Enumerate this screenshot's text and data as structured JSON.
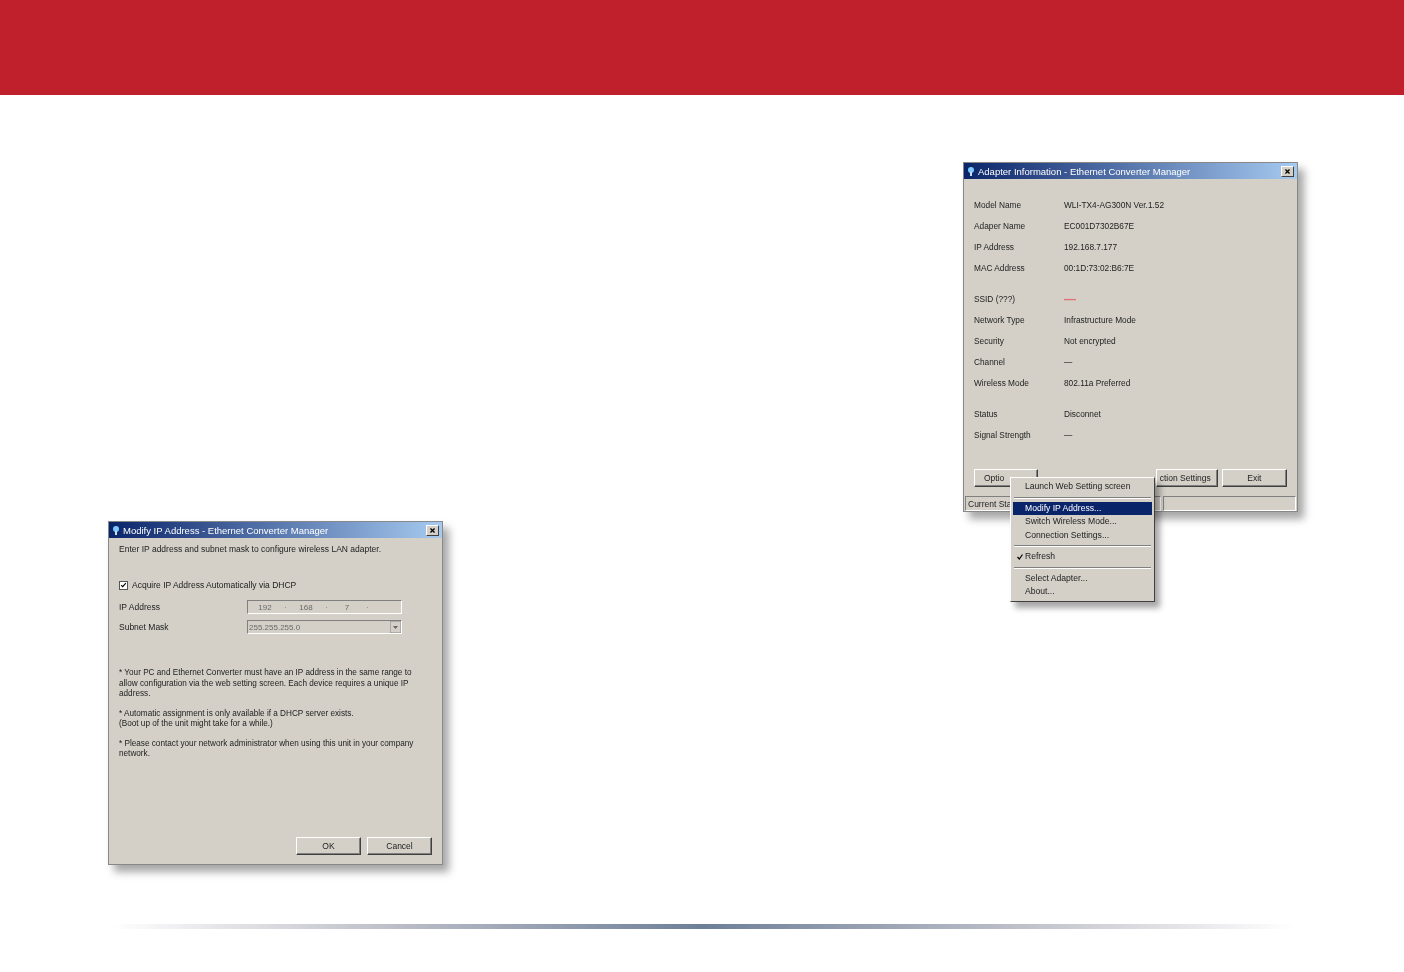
{
  "modify_dialog": {
    "title": "Modify IP Address - Ethernet Converter Manager",
    "instruction": "Enter IP address and subnet mask to configure wireless LAN adapter.",
    "dhcp_checkbox": {
      "label": "Acquire IP Address Automatically via DHCP",
      "checked": true
    },
    "ip_address": {
      "label": "IP Address",
      "octets": [
        "192",
        "168",
        "7"
      ],
      "disabled": true
    },
    "subnet_mask": {
      "label": "Subnet Mask",
      "value": "255.255.255.0",
      "disabled": true
    },
    "notes": [
      "* Your PC and Ethernet Converter must have an IP address in the same range to allow configuration via the web setting screen. Each device requires a unique IP address.",
      "* Automatic assignment is only available if a DHCP server exists.\n (Boot up of the unit might take for a while.)",
      "* Please contact your network administrator when using this unit in your company network."
    ],
    "buttons": [
      "OK",
      "Cancel"
    ]
  },
  "adapter_dialog": {
    "title": "Adapter Information - Ethernet Converter Manager",
    "groups": [
      [
        {
          "label": "Model Name",
          "value": "WLI-TX4-AG300N Ver.1.52"
        },
        {
          "label": "Adaper Name",
          "value": "EC001D7302B67E"
        },
        {
          "label": "IP Address",
          "value": "192.168.7.177"
        },
        {
          "label": "MAC Address",
          "value": "00:1D:73:02:B6:7E"
        }
      ],
      [
        {
          "label": "SSID  (???)",
          "value": "—",
          "color": "#e07070"
        },
        {
          "label": "Network Type",
          "value": "Infrastructure Mode"
        },
        {
          "label": "Security",
          "value": "Not encrypted"
        },
        {
          "label": "Channel",
          "value": "—"
        },
        {
          "label": "Wireless Mode",
          "value": "802.11a Preferred"
        }
      ],
      [
        {
          "label": "Status",
          "value": "Disconnet"
        },
        {
          "label": "Signal Strength",
          "value": "—"
        }
      ]
    ],
    "buttons": [
      "Optio",
      "ction Settings",
      "Exit"
    ],
    "status_bar": [
      "Current Sta"
    ]
  },
  "context_menu": {
    "items": [
      {
        "kind": "item",
        "label": "Launch Web Setting screen",
        "selected": false,
        "checked": false
      },
      {
        "kind": "separator"
      },
      {
        "kind": "item",
        "label": "Modify IP Address...",
        "selected": true,
        "checked": false
      },
      {
        "kind": "item",
        "label": "Switch Wireless Mode...",
        "selected": false,
        "checked": false
      },
      {
        "kind": "item",
        "label": "Connection Settings...",
        "selected": false,
        "checked": false
      },
      {
        "kind": "separator"
      },
      {
        "kind": "item",
        "label": "Refresh",
        "selected": false,
        "checked": true
      },
      {
        "kind": "separator"
      },
      {
        "kind": "item",
        "label": "Select Adapter...",
        "selected": false,
        "checked": false
      },
      {
        "kind": "item",
        "label": "About...",
        "selected": false,
        "checked": false
      }
    ]
  }
}
